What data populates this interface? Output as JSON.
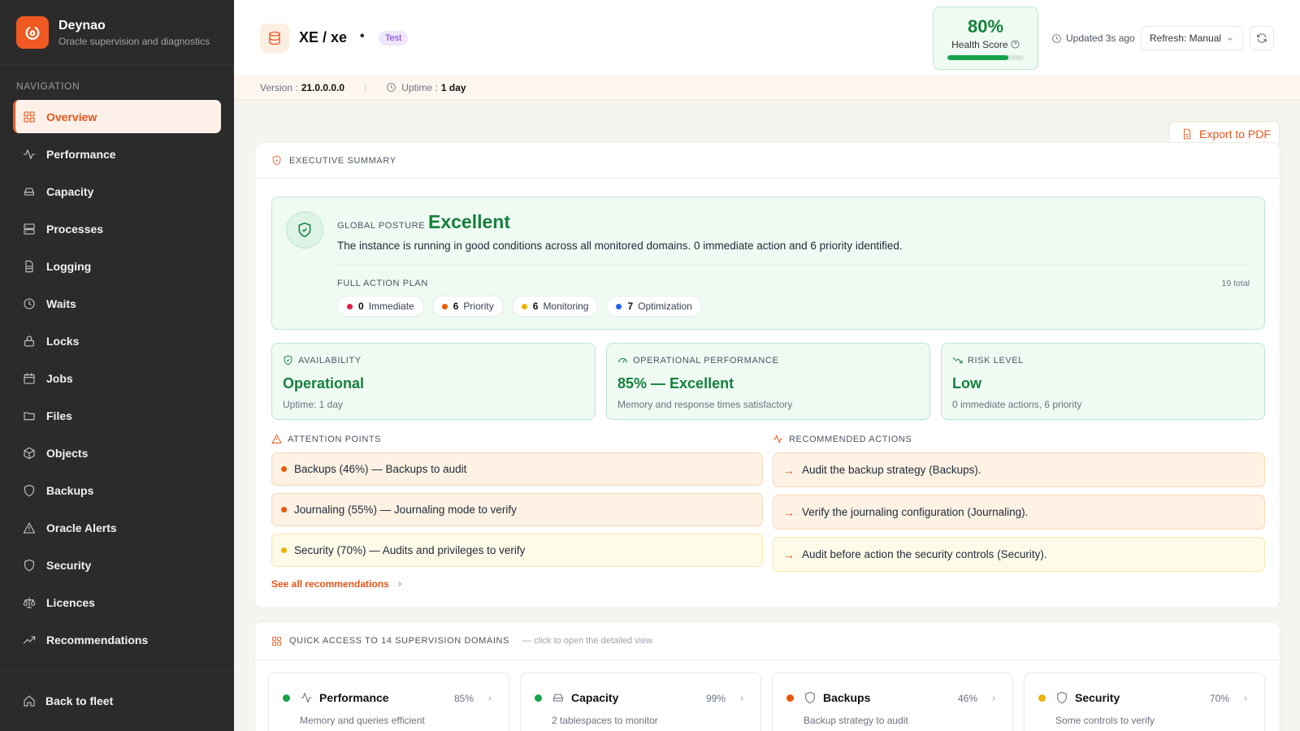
{
  "brand": {
    "name": "Deynao",
    "tagline": "Oracle supervision and diagnostics"
  },
  "nav": {
    "title": "NAVIGATION",
    "items": [
      {
        "label": "Overview",
        "icon": "grid-icon",
        "active": true
      },
      {
        "label": "Performance",
        "icon": "activity-icon"
      },
      {
        "label": "Capacity",
        "icon": "hard-drive-icon"
      },
      {
        "label": "Processes",
        "icon": "server-icon"
      },
      {
        "label": "Logging",
        "icon": "file-text-icon"
      },
      {
        "label": "Waits",
        "icon": "clock-icon"
      },
      {
        "label": "Locks",
        "icon": "lock-icon"
      },
      {
        "label": "Jobs",
        "icon": "calendar-icon"
      },
      {
        "label": "Files",
        "icon": "folder-icon"
      },
      {
        "label": "Objects",
        "icon": "box-icon"
      },
      {
        "label": "Backups",
        "icon": "shield-icon"
      },
      {
        "label": "Oracle Alerts",
        "icon": "alert-triangle-icon"
      },
      {
        "label": "Security",
        "icon": "shield-icon"
      },
      {
        "label": "Licences",
        "icon": "scale-icon"
      },
      {
        "label": "Recommendations",
        "icon": "trending-up-icon"
      }
    ],
    "back": "Back to fleet"
  },
  "header": {
    "title": "XE / xe",
    "separator": "•",
    "env": "Test",
    "health_value": "80%",
    "health_label": "Health Score",
    "health_fraction": 0.8,
    "updated": "Updated 3s ago",
    "refresh": "Refresh: Manual",
    "version_label": "Version :",
    "version": "21.0.0.0.0",
    "uptime_label": "Uptime :",
    "uptime": "1 day"
  },
  "export_label": "Export to PDF",
  "summary": {
    "title": "EXECUTIVE SUMMARY",
    "posture_kicker": "GLOBAL POSTURE",
    "posture_value": "Excellent",
    "posture_desc": "The instance is running in good conditions across all monitored domains. 0 immediate action and 6 priority identified.",
    "plan_title": "FULL ACTION PLAN",
    "plan_total": "19 total",
    "pills": [
      {
        "count": "0",
        "label": "Immediate",
        "color": "#e11d48"
      },
      {
        "count": "6",
        "label": "Priority",
        "color": "#ea580c"
      },
      {
        "count": "6",
        "label": "Monitoring",
        "color": "#eab308"
      },
      {
        "count": "7",
        "label": "Optimization",
        "color": "#2563eb"
      }
    ],
    "kpis": [
      {
        "label": "AVAILABILITY",
        "value": "Operational",
        "sub": "Uptime: 1 day"
      },
      {
        "label": "OPERATIONAL PERFORMANCE",
        "value": "85% — Excellent",
        "sub": "Memory and response times satisfactory"
      },
      {
        "label": "RISK LEVEL",
        "value": "Low",
        "sub": "0 immediate actions, 6 priority"
      }
    ],
    "attention_title": "ATTENTION POINTS",
    "attention": [
      {
        "text": "Backups (46%) — Backups to audit",
        "color": "#ea580c",
        "bg": "#fdf2e4",
        "border": "#f6d9b5"
      },
      {
        "text": "Journaling (55%) — Journaling mode to verify",
        "color": "#ea580c",
        "bg": "#fdf2e4",
        "border": "#f6d9b5"
      },
      {
        "text": "Security (70%) — Audits and privileges to verify",
        "color": "#eab308",
        "bg": "#fefbe8",
        "border": "#f6e7a8"
      }
    ],
    "rec_title": "RECOMMENDED ACTIONS",
    "recs": [
      {
        "text": "Audit the backup strategy (Backups).",
        "bg": "#fdf2e4",
        "border": "#f6d9b5"
      },
      {
        "text": "Verify the journaling configuration (Journaling).",
        "bg": "#fdf2e4",
        "border": "#f6d9b5"
      },
      {
        "text": "Audit before action the security controls (Security).",
        "bg": "#fefbe8",
        "border": "#f6e7a8"
      }
    ],
    "see_all": "See all recommendations"
  },
  "quick": {
    "title": "QUICK ACCESS TO 14 SUPERVISION DOMAINS",
    "hint": "— click to open the detailed view",
    "domains": [
      {
        "name": "Performance",
        "pct": "85%",
        "desc": "Memory and queries efficient",
        "color": "#16a34a",
        "icon": "activity-icon"
      },
      {
        "name": "Capacity",
        "pct": "99%",
        "desc": "2 tablespaces to monitor",
        "color": "#16a34a",
        "icon": "hard-drive-icon"
      },
      {
        "name": "Backups",
        "pct": "46%",
        "desc": "Backup strategy to audit",
        "color": "#ea580c",
        "icon": "shield-icon"
      },
      {
        "name": "Security",
        "pct": "70%",
        "desc": "Some controls to verify",
        "color": "#eab308",
        "icon": "shield-icon"
      }
    ]
  }
}
